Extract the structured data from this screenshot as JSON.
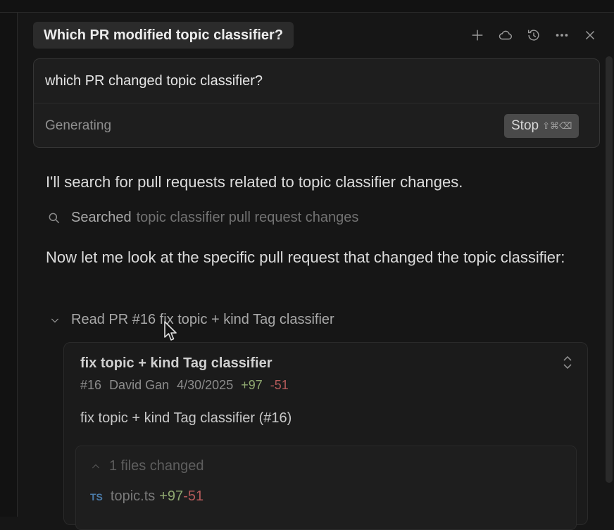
{
  "header": {
    "title": "Which PR modified topic classifier?",
    "icons": [
      "plus-icon",
      "cloud-icon",
      "history-icon",
      "more-icon",
      "close-icon"
    ]
  },
  "input": {
    "query": "which PR changed topic classifier?",
    "status": "Generating",
    "stop_label": "Stop",
    "stop_shortcut": "⇧⌘⌫"
  },
  "conversation": {
    "intro": "I'll search for pull requests related to topic classifier changes.",
    "search": {
      "verb": "Searched",
      "query": "topic classifier pull request changes",
      "icon": "search-icon"
    },
    "follow_up": "Now let me look at the specific pull request that changed the topic classifier:",
    "read": {
      "label": "Read PR #16 fix topic + kind Tag classifier",
      "icon": "chevron-down-icon"
    }
  },
  "pr": {
    "title": "fix topic + kind Tag classifier",
    "number": "#16",
    "author": "David Gan",
    "date": "4/30/2025",
    "additions": "+97",
    "deletions": "-51",
    "commit_message": "fix topic + kind Tag classifier (#16)",
    "files": {
      "summary": "1 files changed",
      "items": [
        {
          "badge": "TS",
          "name": "topic.ts",
          "additions": "+97",
          "deletions": "-51"
        }
      ]
    }
  },
  "colors": {
    "background": "#161616",
    "additions": "#8fa870",
    "deletions": "#b55a5a",
    "ts_badge": "#4a7aa8"
  }
}
